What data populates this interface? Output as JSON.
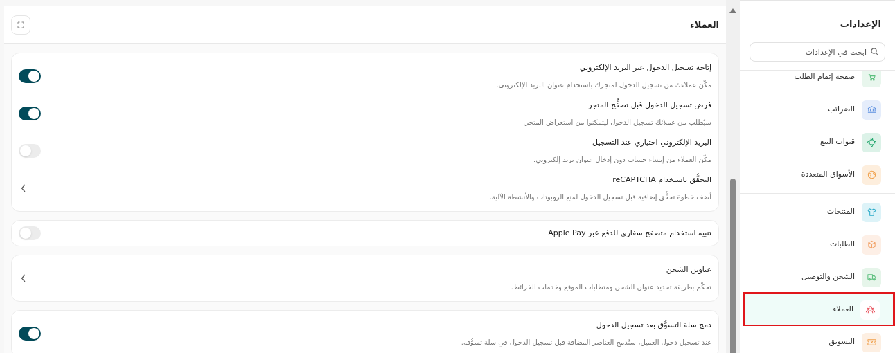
{
  "panel": {
    "title": "العملاء"
  },
  "cards": [
    {
      "rows": [
        {
          "kind": "toggle",
          "title": "إتاحة تسجيل الدخول عبر البريد الإلكتروني",
          "description": "مكّن عملاءك من تسجيل الدخول لمتجرك باستخدام عنوان البريد الإلكتروني.",
          "on": true
        },
        {
          "kind": "toggle",
          "title": "فرض تسجيل الدخول قبل تصفُّح المتجر",
          "description": "سيُطلب من عملائك تسجيل الدخول ليتمكنوا من استعراض المتجر.",
          "on": true
        },
        {
          "kind": "toggle",
          "title": "البريد الإلكتروني اختياري عند التسجيل",
          "description": "مكّن العملاء من إنشاء حساب دون إدخال عنوان بريد إلكتروني.",
          "on": false
        },
        {
          "kind": "link",
          "title": "التحقُّق باستخدام reCAPTCHA",
          "description": "أضف خطوة تحقُّق إضافية قبل تسجيل الدخول لمنع الروبوتات والأنشطة الآلية."
        }
      ]
    },
    {
      "rows": [
        {
          "kind": "toggle",
          "title": "تنبيه استخدام متصفح سفاري للدفع عبر Apple Pay",
          "on": false
        }
      ]
    },
    {
      "rows": [
        {
          "kind": "link",
          "title": "عناوين الشحن",
          "description": "تحكّم بطريقة تحديد عنوان الشحن ومتطلبات الموقع وخدمات الخرائط."
        }
      ]
    },
    {
      "rows": [
        {
          "kind": "toggle",
          "title": "دمج سلة التسوُّق بعد تسجيل الدخول",
          "description": "عند تسجيل دخول العميل، ستُدمج العناصر المضافة قبل تسجيل الدخول في سلة تسوُّقه.",
          "on": true
        }
      ]
    }
  ],
  "sidebar": {
    "title": "الإعدادات",
    "search": {
      "placeholder": "ابحث في الإعدادات"
    },
    "groups": [
      [
        {
          "label": "صفحة إتمام الطلب",
          "selected": false,
          "highlighted": false
        },
        {
          "label": "الضرائب",
          "selected": false,
          "highlighted": false
        },
        {
          "label": "قنوات البيع",
          "selected": false,
          "highlighted": false
        },
        {
          "label": "الأسواق المتعددة",
          "selected": false,
          "highlighted": false
        }
      ],
      [
        {
          "label": "المنتجات",
          "selected": false,
          "highlighted": false
        },
        {
          "label": "الطلبات",
          "selected": false,
          "highlighted": false
        },
        {
          "label": "الشحن والتوصيل",
          "selected": false,
          "highlighted": false
        },
        {
          "label": "العملاء",
          "selected": true,
          "highlighted": true
        },
        {
          "label": "التسويق",
          "selected": false,
          "highlighted": false
        }
      ]
    ]
  }
}
